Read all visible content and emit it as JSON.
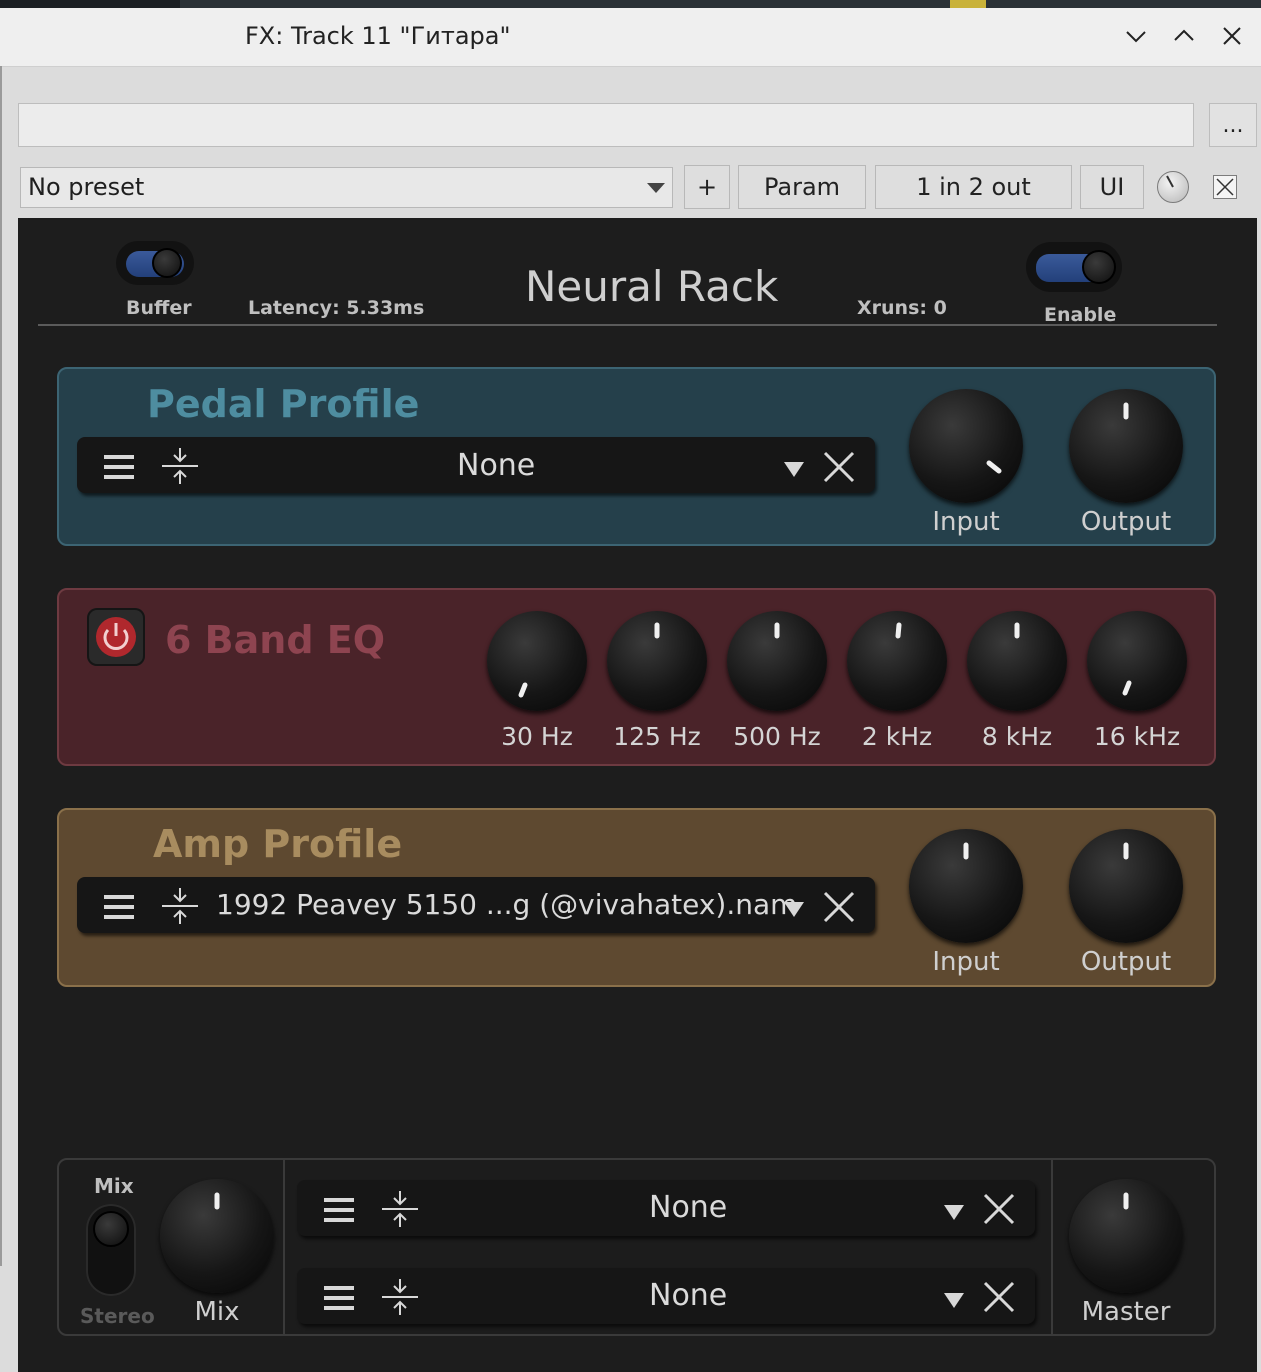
{
  "window": {
    "title": "FX: Track 11 \"Гитара\"",
    "controls": [
      "minimize-chevron-icon",
      "maximize-chevron-icon",
      "close-icon"
    ]
  },
  "host": {
    "more_label": "...",
    "preset": "No preset",
    "plus_label": "+",
    "param_label": "Param",
    "io_label": "1 in 2 out",
    "ui_label": "UI"
  },
  "plugin": {
    "title": "Neural Rack",
    "buffer_label": "Buffer",
    "latency": "Latency: 5.33ms",
    "xruns": "Xruns: 0",
    "enable_label": "Enable",
    "pedal": {
      "title": "Pedal Profile",
      "model": "None",
      "input_label": "Input",
      "output_label": "Output"
    },
    "eq": {
      "title": "6 Band EQ",
      "bands": [
        "30 Hz",
        "125 Hz",
        "500 Hz",
        "2 kHz",
        "8 kHz",
        "16 kHz"
      ]
    },
    "amp": {
      "title": "Amp Profile",
      "model": "1992 Peavey 5150 ...g (@vivahatex).nam",
      "input_label": "Input",
      "output_label": "Output"
    },
    "bottom": {
      "mix_top_label": "Mix",
      "stereo_label": "Stereo",
      "mix_knob_label": "Mix",
      "ir1": "None",
      "ir2": "None",
      "master_label": "Master"
    }
  }
}
